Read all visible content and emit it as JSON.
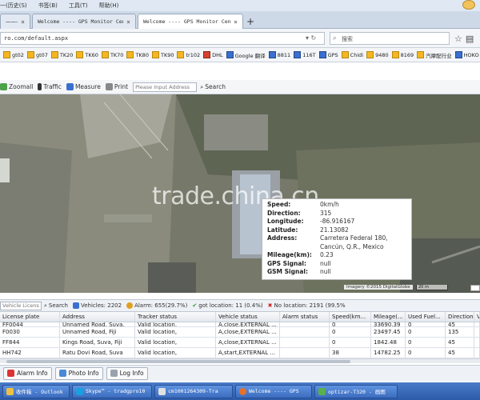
{
  "menu": {
    "items": [
      "一(历史(S)",
      "书签(B)",
      "工具(T)",
      "帮助(H)"
    ]
  },
  "tabs": [
    {
      "label": "一一一一一一一一一",
      "active": false
    },
    {
      "label": "Welcome ---- GPS Monitor Cen",
      "active": false
    },
    {
      "label": "Welcome ---- GPS Monitor Cen",
      "active": true
    }
  ],
  "address": {
    "url": "ro.com/default.aspx",
    "search_placeholder": "搜索"
  },
  "bookmarks": [
    "gt02",
    "gt07",
    "TK20",
    "TK60",
    "TK70",
    "TK80",
    "TK90",
    "tr102",
    "DHL",
    "Google 翻译",
    "8811",
    "116T",
    "GPS",
    "Chidi",
    "9480",
    "8169",
    "汽摩配行业",
    "HOKO",
    "b"
  ],
  "map_toolbar": {
    "zoomall": "Zoomall",
    "traffic": "Traffic",
    "measure": "Measure",
    "print": "Print",
    "address_placeholder": "Please Input Address",
    "search": "Search"
  },
  "map": {
    "watermark": "trade.china.cn",
    "attribution": "Imagery ©2015 DigitalGlobe",
    "scale": "20 m",
    "popup": [
      {
        "k": "Speed:",
        "v": "0km/h"
      },
      {
        "k": "Direction:",
        "v": "315"
      },
      {
        "k": "Longitude:",
        "v": "-86.916167"
      },
      {
        "k": "Latitude:",
        "v": "21.13082"
      },
      {
        "k": "Address:",
        "v": "Carretera Federal 180,"
      },
      {
        "k": "",
        "v": "Cancún, Q.R., Mexico"
      },
      {
        "k": "Mileage(km):",
        "v": "0.23"
      },
      {
        "k": "GPS Signal:",
        "v": "null"
      },
      {
        "k": "GSM Signal:",
        "v": "null"
      }
    ]
  },
  "status": {
    "license_placeholder": "Vehicle License",
    "search": "Search",
    "vehicles": "Vehicles: 2202",
    "alarm": "Alarm: 655(29.7%)",
    "got_location": "got location: 11 (0.4%)",
    "no_location": "No location: 2191 (99.5%"
  },
  "table": {
    "columns": [
      "License plate",
      "Address",
      "Tracker status",
      "Vehicle status",
      "Alarm status",
      "Speed(km...",
      "Mileage(...",
      "Used Fuel...",
      "Direction",
      "V"
    ],
    "rows": [
      [
        "FF0044",
        "Unnamed Road, Suva,",
        "Valid location,",
        "A,close,EXTERNAL ...",
        "",
        "0",
        "33690.39",
        "0",
        "45",
        ""
      ],
      [
        "F0030",
        "Unnamed Road, Fiji",
        "Valid location,",
        "A,close,EXTERNAL ...",
        "",
        "0",
        "23497.45",
        "0",
        "135",
        ""
      ],
      [
        "FF844",
        "Kings Road, Suva, Fiji",
        "Valid location,",
        "A,close,EXTERNAL ...",
        "",
        "0",
        "1842.48",
        "0",
        "45",
        ""
      ],
      [
        "HH742",
        "Ratu Dovi Road, Suva",
        "Valid location,",
        "A,start,EXTERNAL ...",
        "",
        "38",
        "14782.25",
        "0",
        "45",
        ""
      ]
    ]
  },
  "bottom_tabs": [
    "Alarm Info",
    "Photo Info",
    "Log Info"
  ],
  "taskbar": [
    "收件箱 - Outlook",
    "Skype™ - tradgpro10",
    "cm1001264309-Tra",
    "Welcome ---- GPS",
    "optizar-T320 - 画图"
  ]
}
